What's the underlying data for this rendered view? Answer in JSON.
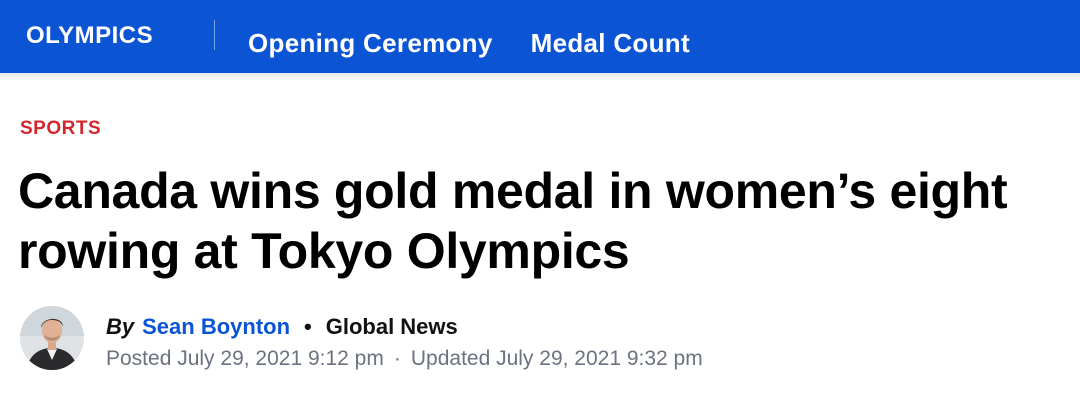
{
  "header": {
    "brand": "OLYMPICS",
    "nav": [
      {
        "label": "Opening Ceremony"
      },
      {
        "label": "Medal Count"
      }
    ]
  },
  "article": {
    "category": "SPORTS",
    "headline": "Canada wins gold medal in women’s eight rowing at Tokyo Olympics",
    "byline": {
      "prefix": "By",
      "author": "Sean Boynton",
      "separator": "•",
      "source": "Global News"
    },
    "dates": {
      "posted": "Posted July 29, 2021 9:12 pm",
      "separator": "·",
      "updated": "Updated July 29, 2021 9:32 pm"
    }
  },
  "colors": {
    "header_bg": "#0b54d4",
    "category": "#d3272d",
    "author_link": "#0b54d4",
    "meta_text": "#6b7280"
  }
}
